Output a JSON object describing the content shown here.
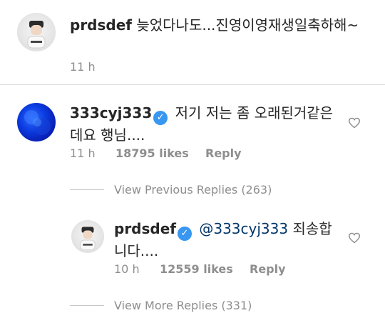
{
  "caption": {
    "username": "prdsdef",
    "text": "늦었다나도...진영이영재생일축하해~",
    "time": "11 h"
  },
  "comment": {
    "username": "333cyj333",
    "verified": true,
    "text": "저기 저는 좀 오래된거같은데요 행님....",
    "time": "11 h",
    "likes": "18795 likes",
    "reply_label": "Reply"
  },
  "view_previous": "View Previous Replies (263)",
  "reply": {
    "username": "prdsdef",
    "verified": true,
    "mention": "@333cyj333",
    "text": " 죄송합니다....",
    "time": "10 h",
    "likes": "12559 likes",
    "reply_label": "Reply"
  },
  "view_more": "View More Replies (331)",
  "colors": {
    "verified": "#3897f0",
    "muted": "#8e8e8e",
    "mention": "#003569"
  }
}
